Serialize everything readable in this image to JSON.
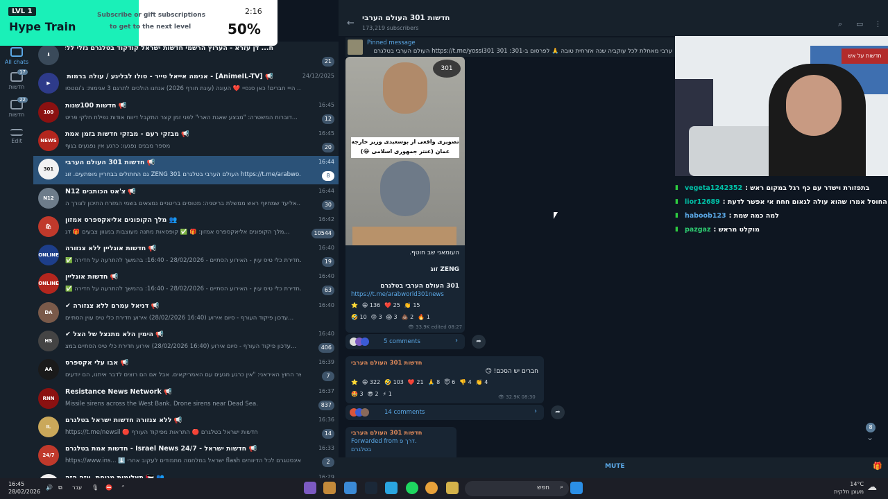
{
  "hype": {
    "level": "LVL 1",
    "title": "Hype Train",
    "subtitle_line1": "Subscribe or gift subscriptions",
    "subtitle_line2": "to get to the next level",
    "timer": "2:16",
    "percent": "50%"
  },
  "rail": {
    "items": [
      {
        "label": "All chats",
        "count": ""
      },
      {
        "label": "חדשות",
        "count": "17"
      },
      {
        "label": "חדשות",
        "count": "22"
      },
      {
        "label": "Edit",
        "count": ""
      }
    ]
  },
  "chats": [
    {
      "name": "ח... דן עזרא - הערוץ הרשמי חדשות ישראל קודקוד בטלגרם גזלי ללא מעצורים",
      "time": "",
      "preview": "",
      "badge": "21",
      "avatar_color": "#3a4a5a",
      "avatar_text": "⬇"
    },
    {
      "name": "📢 [AnimeIL-TV] - אנימה אייאל טייר - סולו לבליגע / עולה ברמות לבדי",
      "time": "24/12/2025",
      "preview": "הייי חברים! כאן סנסיי ❤️ העונה (עונת חורף 2026) אנחנו הולכים לתרגם 3 אנימות: ג'וגוטסו ...",
      "badge": "",
      "avatar_color": "#2e3b8a",
      "avatar_text": "▶"
    },
    {
      "name": "📢 חדשות 100שנות",
      "time": "16:45",
      "preview": "דוברות המשטרה: \"מבצע שאגת הארי\" לפני זמן קצר התקבל דיווח אודות נפילת חלקי פריט...",
      "badge": "12",
      "avatar_color": "#8b1111",
      "avatar_text": "100"
    },
    {
      "name": "📢 מבזקי רעם - מבזקי חדשות בזמן אמת",
      "time": "16:45",
      "preview": "מספר מבנים נפגעו: כרגע אין נפגעים בגוף",
      "badge": "20",
      "avatar_color": "#b3261e",
      "avatar_text": "NEWS"
    },
    {
      "name": "📢 חדשות 301 העולם הערבי",
      "time": "16:44",
      "preview": "גם החתולים בבחריין מופתעים. זוג ZENG 301 העולם הערבי בטלגרם https://t.me/arabwo...",
      "badge": "8",
      "avatar_color": "#f2f2f2",
      "avatar_text": "301"
    },
    {
      "name": "📢 צ'אט הכותבים N12",
      "time": "16:44",
      "preview": "אליעד שמחיוף ראש ממשלת בריטניה: מטוסים בריטניים נמצאים בשמי המזרח התיכון לצורך ה...",
      "badge": "30",
      "avatar_color": "#6d7c8a",
      "avatar_text": "N12"
    },
    {
      "name": "👥 מלך הקופונים אליאקספרס אמזון",
      "time": "16:42",
      "preview": "מלך הקופונים אליאקספרס אמזון: 🎁 ✅ קופסאות מתנה מעוצבות במגוון צבעים 🎁 דג...",
      "badge": "10544",
      "avatar_color": "#c0392b",
      "avatar_text": "🛍"
    },
    {
      "name": "📢 חדשות אונליין ללא צנזורה",
      "time": "16:40",
      "preview": "✅ חדירת כלי טיס עוין - האירוע הסתיים - 28/02/2026 - 16:40: בהמשך להתרעה על חדירה...",
      "badge": "19",
      "avatar_color": "#1d3e8a",
      "avatar_text": "ONLINE"
    },
    {
      "name": "📢 חדשות אונליין",
      "time": "16:40",
      "preview": "✅ חדירת כלי טיס עוין - האירוע הסתיים - 28/02/2026 - 16:40: בהמשך להתרעה על חדירה...",
      "badge": "63",
      "avatar_color": "#b3261e",
      "avatar_text": "ONLINE"
    },
    {
      "name": "📢 דניאל עמרם ללא צנזורה ✔",
      "time": "16:40",
      "preview": "עדכון פיקוד העורף - סיום אירוע (16:40 28/02/2026) אירוע חדירת כלי טיס עוין הסתיים...",
      "badge": "",
      "avatar_color": "#7a5a4a",
      "avatar_text": "DA"
    },
    {
      "name": "📢 הימין הלא מתנצל של הצל ✔",
      "time": "16:40",
      "preview": "עדכון פיקוד העורף - סיום אירוע (16:40 28/02/2026) אירוע חדירת כלי טיס הסתיים במצ...",
      "badge": "406",
      "avatar_color": "#444",
      "avatar_text": "HS"
    },
    {
      "name": "📢 אבו עלי אקספרס",
      "time": "16:39",
      "preview": "שר החוץ האיראני: \"אין כרגע מגעים עם האמריקאים. אבל אם הם רוצים לדבר איתנו, הם יודעים...",
      "badge": "7",
      "avatar_color": "#1a1a1a",
      "avatar_text": "AA"
    },
    {
      "name": "📢 Resistance News Network",
      "time": "16:37",
      "preview": "Missile sirens across the West Bank. Drone sirens near Dead Sea.",
      "badge": "837",
      "avatar_color": "#8b1111",
      "avatar_text": "RNN"
    },
    {
      "name": "📢 ללא צנזורה חדשות ישראל בטלגרם",
      "time": "16:36",
      "preview": "https://t.me/newsil 🔴 חדשות ישראל בטלגרם 🔴 התראות מפיקוד העורף",
      "badge": "14",
      "avatar_color": "#caa85a",
      "avatar_text": "IL"
    },
    {
      "name": "📢 חדשות ישראל - Israel News 24/7 - חדשות אמת בטלגרם",
      "time": "16:33",
      "preview": "https://www.ins... ⬇️ ישראל במלחמה מתמודים לעקוב אחרי flash באינסטגרם לכל הדיווחים ⛔",
      "badge": "2",
      "avatar_color": "#c0392b",
      "avatar_text": "24/7"
    },
    {
      "name": "👥 🇵🇸 תעלומות מנוחת, עזה הזה",
      "time": "16:29",
      "preview": "",
      "badge": "",
      "avatar_color": "#eee",
      "avatar_text": ""
    }
  ],
  "header": {
    "title": "חדשות 301 העולם הערבי",
    "subscribers": "173,219 subscribers"
  },
  "pinned": {
    "label": "Pinned message",
    "text": "ערבי מאחלת לכל עוקביה שנה אזרחית טובה 🙏 לפרסום ב-301: https://t.me/yossi301 301 העולם הערבי בטלגרם"
  },
  "post1": {
    "caption_overlay": "تصویری واقعی از بوسعیدی وزیر خارجه عمان (عنتر جمهوری اسلامی 😂)",
    "line1": "העומאני שב חוטף.",
    "line2": "זוג ZENG",
    "line3": "301 העולם הערבי בטלגרם",
    "link": "https://t.me/arabworld301news",
    "reactions_row1": [
      "⭐",
      "😁 136",
      "❤️ 25",
      "👏 15"
    ],
    "reactions_row2": [
      "🤣 10",
      "😡 3",
      "😱 3",
      "💩 2",
      "🔥 1"
    ],
    "views": "33.9K",
    "edited": "edited 08:27",
    "comments": "5 comments"
  },
  "post2": {
    "author": "חדשות 301 העולם הערבי",
    "text": "חברים יש הסכם! 😏",
    "reactions_row1": [
      "⭐",
      "😁 322",
      "🤣 103",
      "❤️ 21",
      "🙏 8",
      "😇 6",
      "👎 4",
      "👏 4"
    ],
    "reactions_row2": [
      "🤩 3",
      "😎 2",
      "⚡ 1"
    ],
    "views": "32.9K",
    "time": "08:30",
    "comments": "14 comments"
  },
  "post3": {
    "author": "חדשות 301 העולם הערבי",
    "forwarded_label": "Forwarded from",
    "forwarded_name": "דרך פ.",
    "forwarded_sub": "בטלגרם"
  },
  "scroll_badge": "8",
  "mute_label": "MUTE",
  "cam": {
    "sign_text": "חדשות על אש"
  },
  "stream_chat": [
    {
      "user": "vegeta1242352",
      "color": "#00c2a8",
      "msg": "בתפזורת וישדר עם כף רגל במקום ראש"
    },
    {
      "user": "lior12689",
      "color": "#00c2a8",
      "msg": "החוסל אמרו שהוא עולה לגאום חחח אי אפשר לדעת"
    },
    {
      "user": "haboob123",
      "color": "#5ba8e6",
      "msg": "למה כמה שמת"
    },
    {
      "user": "pazgaz",
      "color": "#2ecc71",
      "msg": "מוקלט מראש"
    }
  ],
  "taskbar": {
    "time": "16:45",
    "date": "28/02/2026",
    "lang": "עבר",
    "search_placeholder": "חפש",
    "temp": "14°C",
    "weather": "מעונן חלקית"
  },
  "colors": {
    "accent": "#5ba8e6",
    "selected": "#2b5278",
    "panel": "#17212b",
    "bg": "#0e1621",
    "hype": "#1af0b8"
  }
}
